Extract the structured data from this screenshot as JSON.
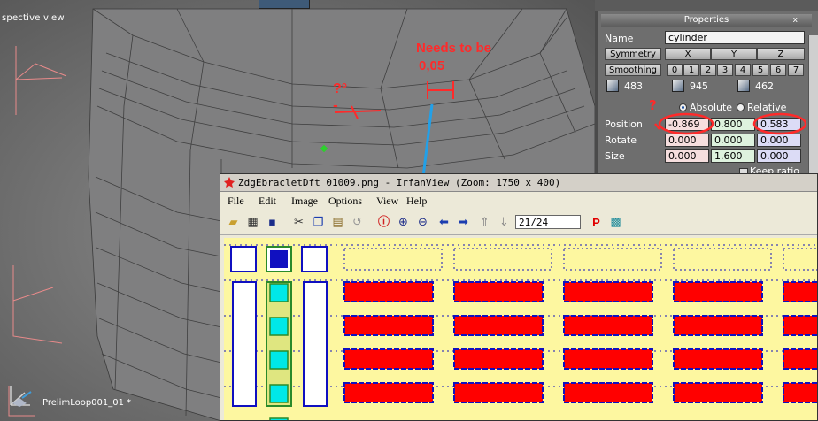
{
  "viewport": {
    "view_label": "spective view",
    "object_label": "PrelimLoop001_01 *",
    "annotation_note": "Needs to be",
    "annotation_value": "0,05",
    "annotation_angle": "?°",
    "annotation_q": "?",
    "annotation_dash": "-"
  },
  "properties": {
    "title": "Properties",
    "close": "x",
    "name_label": "Name",
    "name_value": "cylinder",
    "symmetry_label": "Symmetry",
    "axes": [
      "X",
      "Y",
      "Z"
    ],
    "smoothing_label": "Smoothing",
    "smoothing_groups": [
      "0",
      "1",
      "2",
      "3",
      "4",
      "5",
      "6",
      "7"
    ],
    "counts": [
      "483",
      "945",
      "462"
    ],
    "absolute_label": "Absolute",
    "relative_label": "Relative",
    "position_label": "Position",
    "rotate_label": "Rotate",
    "size_label": "Size",
    "position": [
      "-0.869",
      "0.800",
      "0.583"
    ],
    "rotate": [
      "0.000",
      "0.000",
      "0.000"
    ],
    "size": [
      "0.000",
      "1.600",
      "0.000"
    ],
    "keep_ratio_label": "Keep ratio"
  },
  "irfanview": {
    "title": "ZdgEbracletDft_01009.png - IrfanView (Zoom: 1750 x 400)",
    "menu": [
      "File",
      "Edit",
      "Image",
      "Options",
      "View",
      "Help"
    ],
    "page_counter": "21/24",
    "toolbar_icons": [
      "open-icon",
      "slideshow-icon",
      "save-icon",
      "cut-icon",
      "copy-icon",
      "paste-icon",
      "undo-icon",
      "info-icon",
      "zoom-in-icon",
      "zoom-out-icon",
      "prev-icon",
      "next-icon",
      "first-page-icon",
      "last-page-icon",
      "print-icon",
      "paint-icon"
    ]
  },
  "colors": {
    "annotation_red": "#ff2a2a",
    "selection_blue": "#22a0e8",
    "sprite_red": "#ff0000",
    "sprite_blue": "#1010c0",
    "sprite_cyan": "#00e8e8",
    "canvas_yellow": "#fdf7a0"
  }
}
